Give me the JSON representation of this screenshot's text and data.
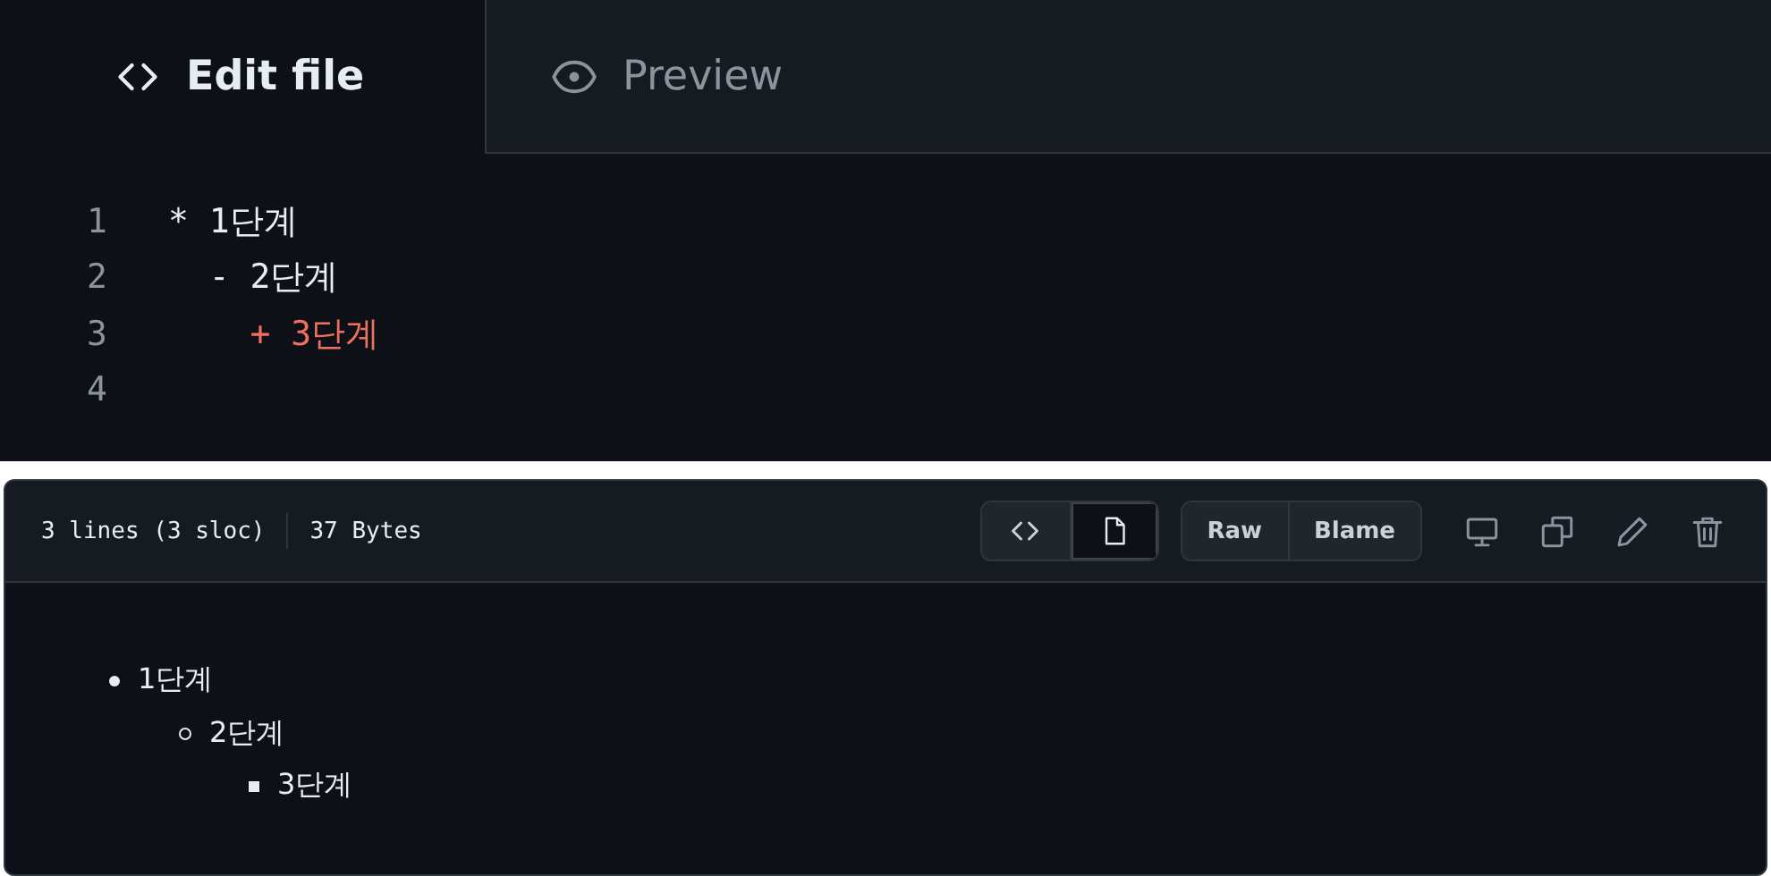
{
  "editor": {
    "tabs": [
      {
        "label": "Edit file",
        "kind": "code",
        "selected": true
      },
      {
        "label": "Preview",
        "kind": "eye",
        "selected": false
      }
    ],
    "lines": [
      {
        "number": "1",
        "text": "* 1단계",
        "color": "#e6edf3"
      },
      {
        "number": "2",
        "text": "  - 2단계",
        "color": "#e6edf3"
      },
      {
        "number": "3",
        "text": "    + 3단계",
        "color": "#f0705f"
      },
      {
        "number": "4"
      }
    ]
  },
  "file_view": {
    "header": {
      "lines_info": "3 lines (3 sloc)",
      "size": "37 Bytes",
      "view_toggle": [
        {
          "kind": "code",
          "selected": false
        },
        {
          "kind": "file",
          "selected": true
        }
      ],
      "buttons": [
        "Raw",
        "Blame"
      ],
      "actions": [
        {
          "kind": "monitor"
        },
        {
          "kind": "copy"
        },
        {
          "kind": "pencil"
        },
        {
          "kind": "trash"
        }
      ]
    },
    "list": [
      {
        "text": "1단계",
        "children": [
          {
            "text": "2단계",
            "children": [
              {
                "text": "3단계"
              }
            ]
          }
        ]
      }
    ]
  }
}
